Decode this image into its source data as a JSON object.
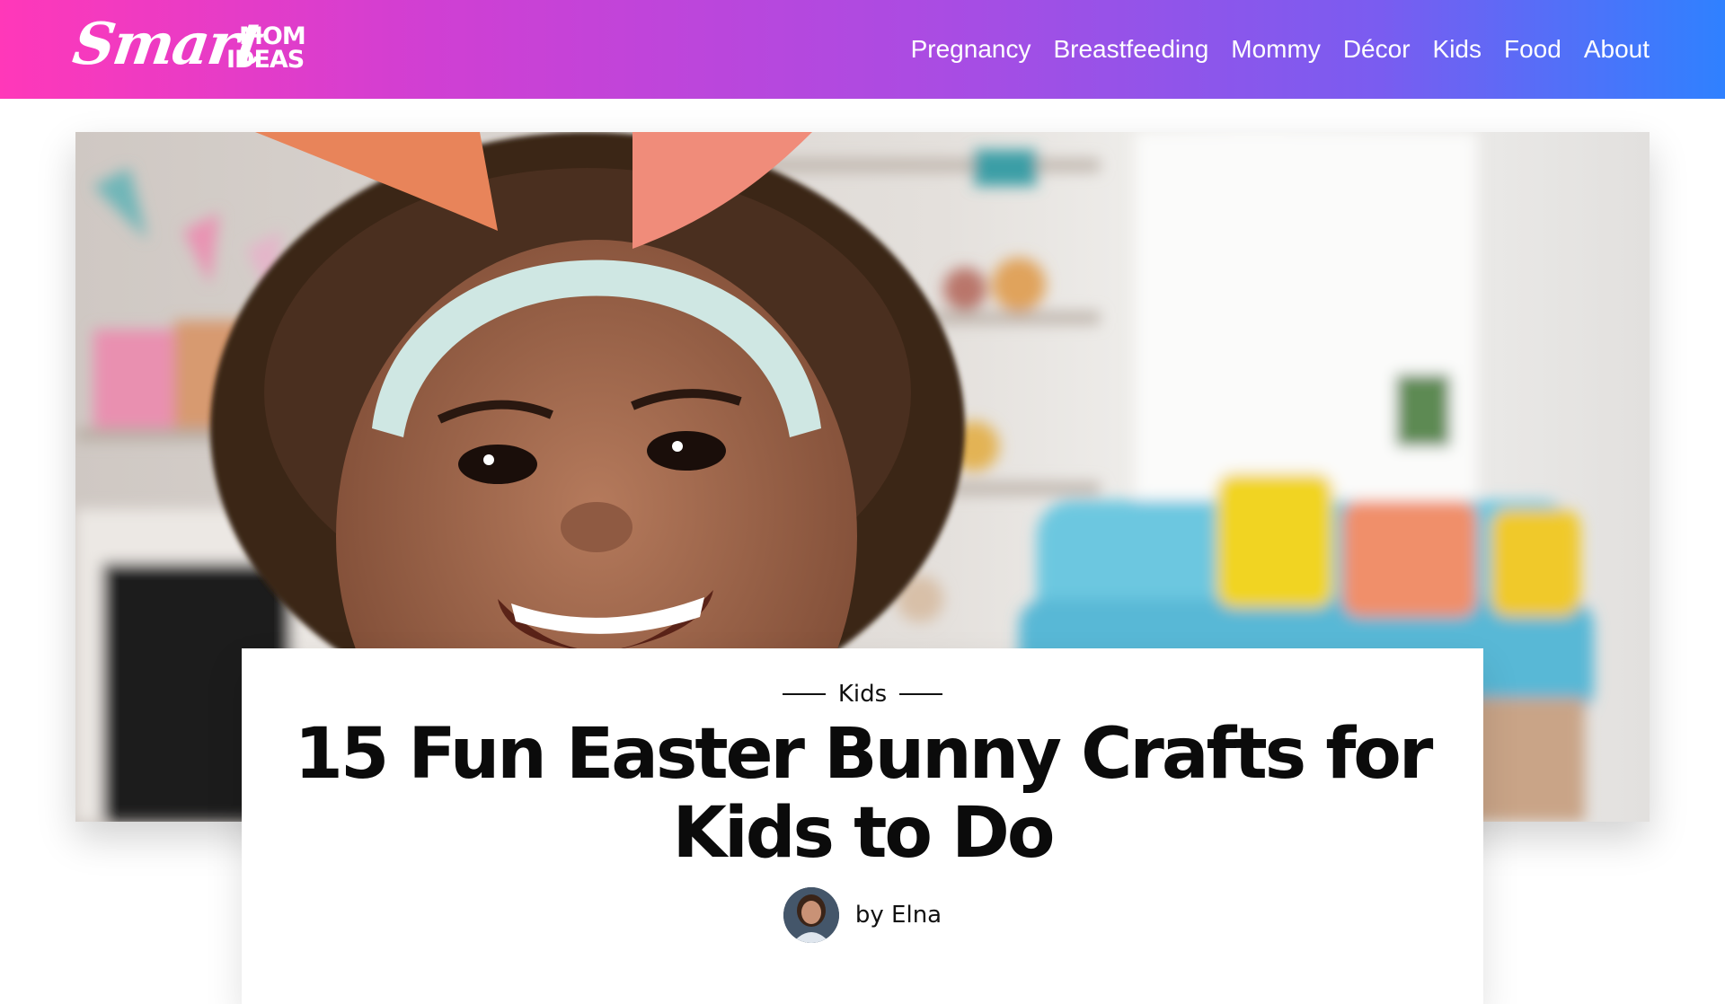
{
  "header": {
    "logo": {
      "script": "Smart",
      "top_word": "MOM",
      "bottom_word": "IDEAS"
    },
    "nav": [
      {
        "label": "Pregnancy"
      },
      {
        "label": "Breastfeeding"
      },
      {
        "label": "Mommy"
      },
      {
        "label": "Décor"
      },
      {
        "label": "Kids"
      },
      {
        "label": "Food"
      },
      {
        "label": "About"
      }
    ]
  },
  "hero": {
    "image_alt": "Smiling girl wearing paper bunny ears headband"
  },
  "post": {
    "category": "Kids",
    "title": "15 Fun Easter Bunny Crafts for Kids to Do",
    "byline": "by Elna"
  },
  "colors": {
    "header_gradient_start": "#ff38b9",
    "header_gradient_end": "#2f81ff",
    "title_text": "#0b0b0b"
  }
}
